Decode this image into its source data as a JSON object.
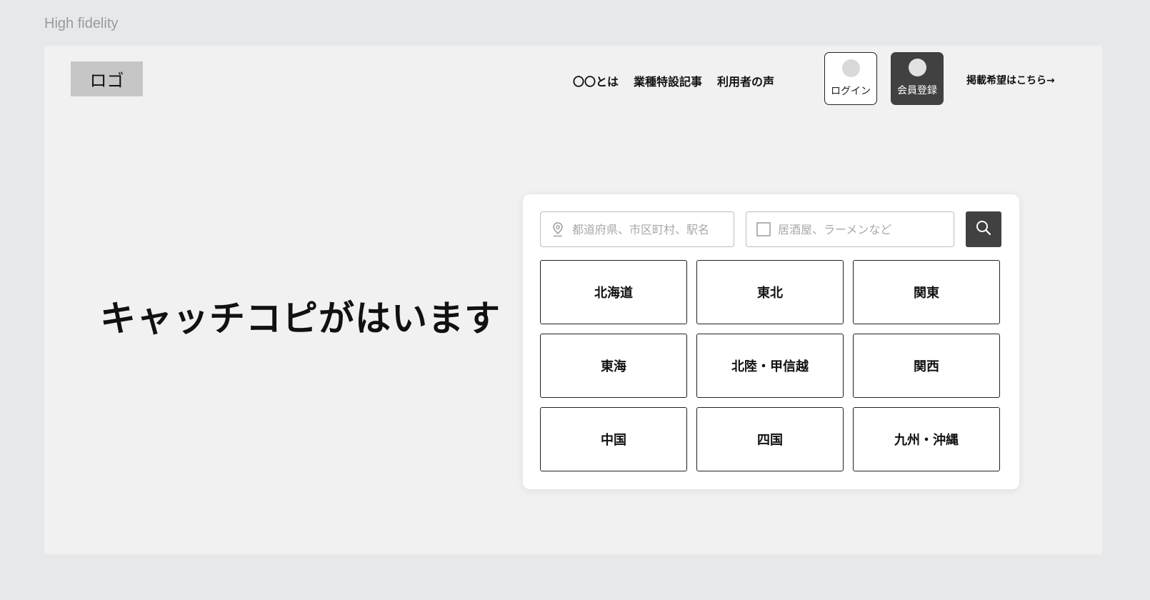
{
  "canvas": {
    "label": "High fidelity"
  },
  "header": {
    "logo": "ロゴ",
    "nav": [
      "〇〇とは",
      "業種特設記事",
      "利用者の声"
    ],
    "login_label": "ログイン",
    "signup_label": "会員登録",
    "listing_link": "掲載希望はこちら→"
  },
  "hero": {
    "catch_copy": "キャッチコピがはいます"
  },
  "search": {
    "area_placeholder": "都道府県、市区町村、駅名",
    "genre_placeholder": "居酒屋、ラーメンなど",
    "regions": [
      "北海道",
      "東北",
      "関東",
      "東海",
      "北陸・甲信越",
      "関西",
      "中国",
      "四国",
      "九州・沖縄"
    ]
  },
  "icons": {
    "area": "map-pin-icon",
    "genre": "checkbox-icon",
    "search": "search-icon"
  },
  "colors": {
    "background": "#e7e8ea",
    "frame": "#f1f1f1",
    "logo_box": "#c6c6c6",
    "dark_button": "#414141",
    "text": "#111111"
  }
}
